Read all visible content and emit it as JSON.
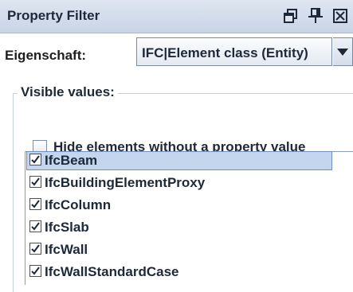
{
  "panel": {
    "title": "Property Filter",
    "window_buttons": [
      {
        "icon": "undock-icon"
      },
      {
        "icon": "pin-icon"
      },
      {
        "icon": "close-icon"
      }
    ]
  },
  "property": {
    "label": "Eigenschaft:",
    "selected_value": "IFC|Element class (Entity)",
    "arrow_icon": "dropdown-arrow-icon"
  },
  "visible_values": {
    "title": "Visible values:",
    "hide_without_value": {
      "label": "Hide elements without a property value",
      "checked": false
    },
    "items": [
      {
        "label": "IfcBeam",
        "checked": true,
        "selected": true
      },
      {
        "label": "IfcBuildingElementProxy",
        "checked": true,
        "selected": false
      },
      {
        "label": "IfcColumn",
        "checked": true,
        "selected": false
      },
      {
        "label": "IfcSlab",
        "checked": true,
        "selected": false
      },
      {
        "label": "IfcWall",
        "checked": true,
        "selected": false
      },
      {
        "label": "IfcWallStandardCase",
        "checked": true,
        "selected": false
      }
    ]
  },
  "colors": {
    "titlebar": "#c9d4e6",
    "selection": "#c4d6ee",
    "selection_border": "#6f8fbf"
  }
}
